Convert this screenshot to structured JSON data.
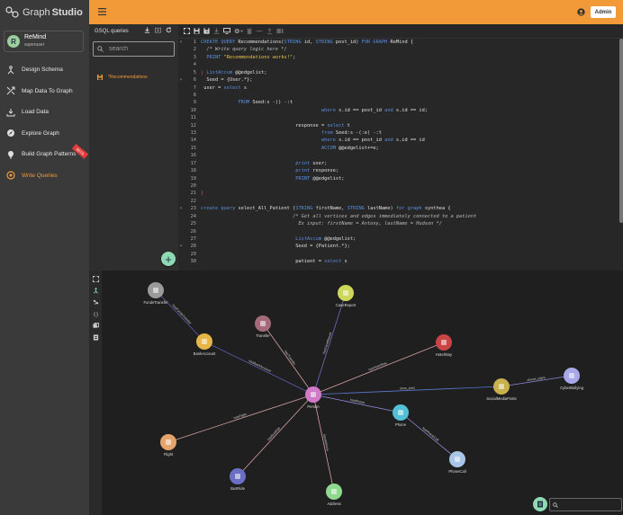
{
  "app": {
    "brand_prefix": "Graph",
    "brand_suffix": "Studio"
  },
  "user": {
    "initial": "R",
    "name": "ReMind",
    "role": "superuser"
  },
  "nav": [
    {
      "label": "Design Schema",
      "icon": "design-schema-icon"
    },
    {
      "label": "Map Data To Graph",
      "icon": "map-data-icon"
    },
    {
      "label": "Load Data",
      "icon": "load-data-icon"
    },
    {
      "label": "Explore Graph",
      "icon": "explore-graph-icon"
    },
    {
      "label": "Build Graph Patterns",
      "icon": "build-patterns-icon",
      "badge": "BETA"
    },
    {
      "label": "Write Queries",
      "icon": "write-queries-icon",
      "active": true
    }
  ],
  "topbar": {
    "admin_label": "Admin"
  },
  "gsql_panel": {
    "title": "GSQL queries",
    "search_placeholder": "search",
    "query_name": "Recommendations",
    "query_status": "*"
  },
  "graph_search": {
    "placeholder": ""
  },
  "colors": {
    "accent": "#f29a38",
    "sidebar": "#3a3a3a",
    "editor_bg": "#272727",
    "graph_bg": "#1f1f1f",
    "fab": "#8fd9b5"
  },
  "graph": {
    "nodes": [
      {
        "id": "FundsTransfer",
        "label": "FundsTransfer",
        "color": "#9a9a9a",
        "icon": "funds-transfer-icon"
      },
      {
        "id": "CaseReport",
        "label": "CaseReport",
        "color": "#cdd75a",
        "icon": "case-report-icon"
      },
      {
        "id": "Transfer",
        "label": "Transfer",
        "color": "#a46a7c",
        "icon": "transfer-icon"
      },
      {
        "id": "BankAccount",
        "label": "BankAccount",
        "color": "#e8b548",
        "icon": "bank-account-icon"
      },
      {
        "id": "HotelStay",
        "label": "HotelStay",
        "color": "#c94444",
        "icon": "hotel-stay-icon"
      },
      {
        "id": "SocialMediaPosts",
        "label": "SocialMediaPosts",
        "color": "#c8b04d",
        "icon": "social-media-icon"
      },
      {
        "id": "CyberBullying",
        "label": "CyberBullying",
        "color": "#a8a8e8",
        "icon": "cyber-bullying-icon"
      },
      {
        "id": "Person",
        "label": "Person",
        "color": "#d17ac9",
        "icon": "person-icon"
      },
      {
        "id": "Phone",
        "label": "Phone",
        "color": "#54c0d6",
        "icon": "phone-icon"
      },
      {
        "id": "Flight",
        "label": "Flight",
        "color": "#e4a56c",
        "icon": "flight-icon"
      },
      {
        "id": "PhoneCall",
        "label": "PhoneCall",
        "color": "#a9c6e8",
        "icon": "phone-call-icon"
      },
      {
        "id": "BusRide",
        "label": "BusRide",
        "color": "#6a6fc4",
        "icon": "bus-ride-icon"
      },
      {
        "id": "Address",
        "label": "Address",
        "color": "#8fd98f",
        "icon": "address-icon"
      }
    ],
    "edges": [
      {
        "from": "FundsTransfer",
        "to": "BankAccount",
        "label": "hasFundsTransfer"
      },
      {
        "from": "BankAccount",
        "to": "Person",
        "label": "hasBankAccount"
      },
      {
        "from": "Transfer",
        "to": "Person",
        "label": "hasTransfer"
      },
      {
        "from": "CaseReport",
        "to": "Person",
        "label": "hasCaseReport"
      },
      {
        "from": "HotelStay",
        "to": "Person",
        "label": "hasHotelStay"
      },
      {
        "from": "Person",
        "to": "SocialMediaPosts",
        "label": "does_post"
      },
      {
        "from": "SocialMediaPosts",
        "to": "CyberBullying",
        "label": "shows_signs"
      },
      {
        "from": "Person",
        "to": "Phone",
        "label": "hasPhone"
      },
      {
        "from": "Phone",
        "to": "PhoneCall",
        "label": "hasPhoneCall"
      },
      {
        "from": "Flight",
        "to": "Person",
        "label": "hasFlight"
      },
      {
        "from": "BusRide",
        "to": "Person",
        "label": "hasBusRide"
      },
      {
        "from": "Person",
        "to": "Address",
        "label": "hasAddress"
      }
    ]
  },
  "code_lines": [
    {
      "n": "1",
      "fold": "▾",
      "src": "<span class=\"kw\">CREATE QUERY</span> Recommendations(<span class=\"kw\">STRING</span> id, <span class=\"kw\">STRING</span> post_id) <span class=\"kw\">FOR GRAPH</span> ReMind {"
    },
    {
      "n": "2",
      "fold": "",
      "src": "  <span class=\"cm\">/* Write query logic here */</span>"
    },
    {
      "n": "3",
      "fold": "",
      "src": "  <span class=\"kw\">PRINT</span> <span class=\"str\">\"Recommendations works!\"</span>;"
    },
    {
      "n": "4",
      "fold": "",
      "src": ""
    },
    {
      "n": "5",
      "fold": "",
      "src": "<span class=\"cur\">|</span> <span class=\"kw\">ListAccum</span> @@edgelist;"
    },
    {
      "n": "6",
      "fold": "▾",
      "src": "  Seed = {User.*};"
    },
    {
      "n": "7",
      "fold": "",
      "src": " user = <span class=\"kw\">select</span> s"
    },
    {
      "n": "8",
      "fold": "",
      "src": ""
    },
    {
      "n": "9",
      "fold": "",
      "src": "             <span class=\"kw\">FROM</span> Seed:s -() -:t"
    },
    {
      "n": "10",
      "fold": "",
      "src": "                                          <span class=\"kw\">where</span> s.id == post_id <span class=\"kw\">and</span> s.id == id;"
    },
    {
      "n": "11",
      "fold": "",
      "src": ""
    },
    {
      "n": "12",
      "fold": "",
      "src": "                                 response = <span class=\"kw\">select</span> t"
    },
    {
      "n": "13",
      "fold": "",
      "src": "                                          <span class=\"kw\">from</span> Seed:s -(:e) -:t"
    },
    {
      "n": "14",
      "fold": "",
      "src": "                                          <span class=\"kw\">where</span> s.id == post_id <span class=\"kw\">and</span> s.id == id"
    },
    {
      "n": "15",
      "fold": "",
      "src": "                                          <span class=\"kw\">ACCUM</span> @@edgelist+=e;"
    },
    {
      "n": "16",
      "fold": "",
      "src": ""
    },
    {
      "n": "17",
      "fold": "",
      "src": "                                 <span class=\"kw\">print</span> user;"
    },
    {
      "n": "18",
      "fold": "",
      "src": "                                 <span class=\"kw\">print</span> response;"
    },
    {
      "n": "19",
      "fold": "",
      "src": "                                 <span class=\"kw\">PRINT</span> @@edgelist;"
    },
    {
      "n": "20",
      "fold": "",
      "src": ""
    },
    {
      "n": "21",
      "fold": "",
      "src": "<span class=\"cur\">}</span>"
    },
    {
      "n": "22",
      "fold": "",
      "src": ""
    },
    {
      "n": "23",
      "fold": "▾",
      "src": "<span class=\"kw\">create query</span> select_All_Patient (<span class=\"kw\">STRING</span> firstName, <span class=\"kw\">STRING</span> lastName) <span class=\"kw\">for graph</span> synthea {"
    },
    {
      "n": "24",
      "fold": "",
      "src": "                                <span class=\"cm\">/* Get all vertices and edges immediately connected to a patient</span>"
    },
    {
      "n": "25",
      "fold": "",
      "src": "                                <span class=\"cm\">  Ex input: firstName = Antony, lastName = Hudson */</span>"
    },
    {
      "n": "26",
      "fold": "",
      "src": ""
    },
    {
      "n": "27",
      "fold": "",
      "src": "                                 <span class=\"kw\">ListAccum</span> @@edgelist;"
    },
    {
      "n": "28",
      "fold": "▾",
      "src": "                                 Seed = {Patient.*};"
    },
    {
      "n": "29",
      "fold": "",
      "src": ""
    },
    {
      "n": "30",
      "fold": "",
      "src": "                                 patient = <span class=\"kw\">select</span> s"
    }
  ]
}
